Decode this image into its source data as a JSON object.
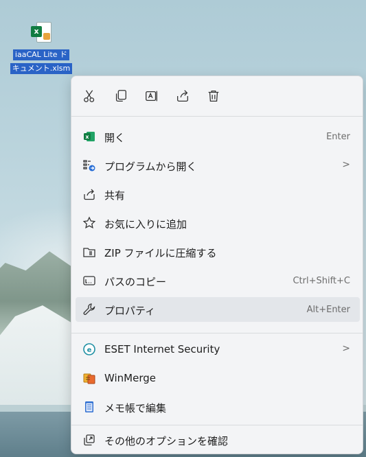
{
  "desktop": {
    "file_label": "iaaCAL Liteドキュメント.xlsm",
    "file_label_line1": "iaaCAL Lite ド",
    "file_label_line2": "キュメント.xlsm"
  },
  "context_menu": {
    "quick_actions": [
      {
        "name": "cut",
        "icon": "scissors-icon"
      },
      {
        "name": "copy",
        "icon": "copy-icon"
      },
      {
        "name": "rename",
        "icon": "rename-icon"
      },
      {
        "name": "share",
        "icon": "share-icon"
      },
      {
        "name": "delete",
        "icon": "trash-icon"
      }
    ],
    "items": [
      {
        "label": "開く",
        "shortcut": "Enter",
        "icon": "excel-icon"
      },
      {
        "label": "プログラムから開く",
        "submenu": ">",
        "icon": "open-with-icon"
      },
      {
        "label": "共有",
        "icon": "share-icon"
      },
      {
        "label": "お気に入りに追加",
        "icon": "star-icon"
      },
      {
        "label": "ZIP ファイルに圧縮する",
        "icon": "zip-icon"
      },
      {
        "label": "パスのコピー",
        "shortcut": "Ctrl+Shift+C",
        "icon": "path-icon"
      },
      {
        "label": "プロパティ",
        "shortcut": "Alt+Enter",
        "icon": "wrench-icon"
      },
      {
        "label": "ESET Internet Security",
        "submenu": ">",
        "icon": "eset-icon"
      },
      {
        "label": "WinMerge",
        "icon": "winmerge-icon"
      },
      {
        "label": "メモ帳で編集",
        "icon": "notepad-icon"
      },
      {
        "label": "その他のオプションを確認",
        "icon": "more-options-icon"
      }
    ]
  },
  "colors": {
    "menu_bg": "#f3f4f6",
    "hover_bg": "#e3e6ea",
    "excel_green": "#107c41",
    "eset_teal": "#1e8fa3"
  }
}
